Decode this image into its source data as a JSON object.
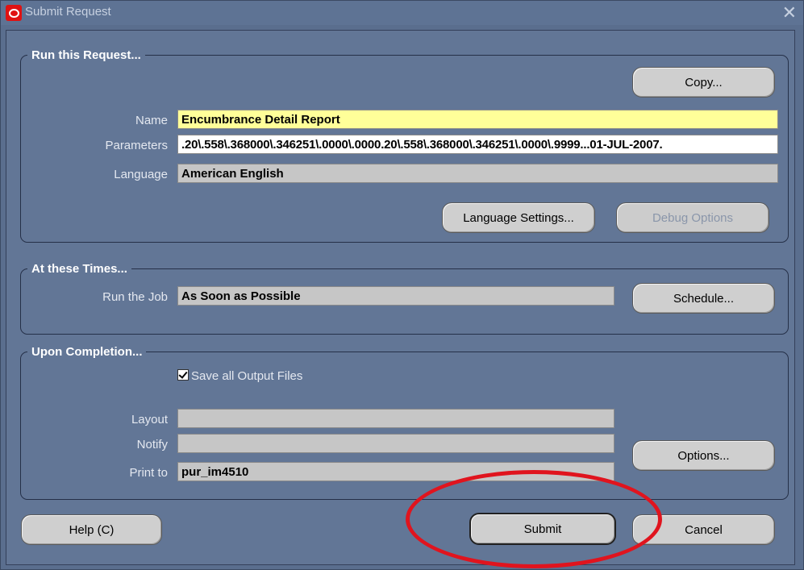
{
  "window": {
    "title": "Submit Request",
    "close_glyph": "✕"
  },
  "run_request": {
    "legend": "Run this Request...",
    "copy_button": "Copy...",
    "name_label": "Name",
    "name_value": "Encumbrance Detail Report",
    "parameters_label": "Parameters",
    "parameters_value": ".20\\.558\\.368000\\.346251\\.0000\\.0000.20\\.558\\.368000\\.346251\\.0000\\.9999...01-JUL-2007.",
    "language_label": "Language",
    "language_value": "American English",
    "language_settings_button": "Language Settings...",
    "debug_options_button": "Debug Options"
  },
  "times": {
    "legend": "At these Times...",
    "run_job_label": "Run the Job",
    "run_job_value": "As Soon as Possible",
    "schedule_button": "Schedule..."
  },
  "completion": {
    "legend": "Upon Completion...",
    "save_output_label": "Save all Output Files",
    "save_output_checked": true,
    "layout_label": "Layout",
    "layout_value": "",
    "notify_label": "Notify",
    "notify_value": "",
    "print_to_label": "Print to",
    "print_to_value": "pur_im4510",
    "options_button": "Options..."
  },
  "footer": {
    "help_button": "Help (C)",
    "submit_button": "Submit",
    "cancel_button": "Cancel"
  },
  "colors": {
    "window_bg": "#627696",
    "highlight_ellipse": "#e0141e",
    "name_field_bg": "#ffff99"
  },
  "icons": {
    "app_icon": "oracle-icon",
    "close": "close-icon",
    "checkbox": "checkbox-checked-icon"
  }
}
